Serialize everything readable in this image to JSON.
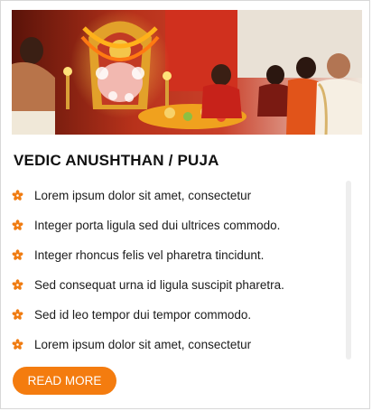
{
  "card": {
    "image_alt": "Priests performing a puja before a decorated deity",
    "title": "VEDIC ANUSHTHAN / PUJA",
    "items": [
      {
        "label": "Lorem ipsum dolor sit amet, consectetur",
        "icon": "orange-flower-icon"
      },
      {
        "label": "Integer porta ligula sed dui ultrices commodo.",
        "icon": "orange-flower-icon"
      },
      {
        "label": "Integer rhoncus felis vel pharetra tincidunt.",
        "icon": "orange-flower-icon"
      },
      {
        "label": "Sed consequat urna id ligula suscipit pharetra.",
        "icon": "orange-flower-icon"
      },
      {
        "label": "Sed id leo tempor dui tempor commodo.",
        "icon": "orange-flower-icon"
      },
      {
        "label": "Lorem ipsum dolor sit amet, consectetur",
        "icon": "orange-flower-icon"
      }
    ],
    "button_label": "READ MORE"
  },
  "colors": {
    "accent": "#f47c0f",
    "bullet": "#f07c12",
    "title_text": "#111111",
    "body_text": "#1b1b1b",
    "border": "#d8d8d8"
  }
}
